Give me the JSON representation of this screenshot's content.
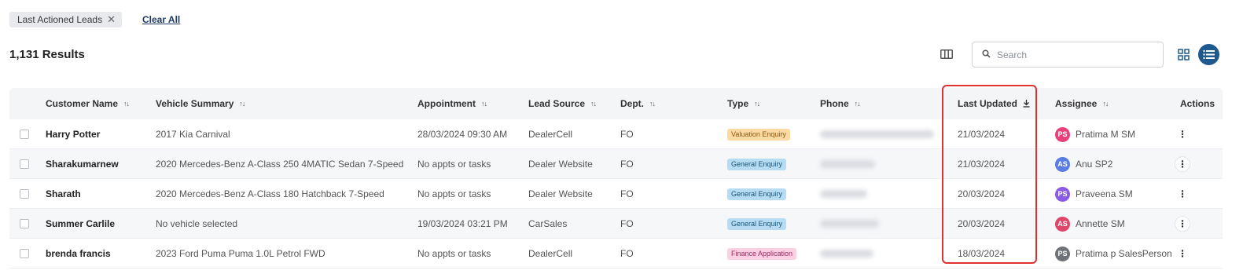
{
  "filters": {
    "chip_label": "Last Actioned Leads",
    "clear_all": "Clear All"
  },
  "results_label": "1,131 Results",
  "search": {
    "placeholder": "Search"
  },
  "table": {
    "headers": {
      "customer_name": "Customer Name",
      "vehicle_summary": "Vehicle Summary",
      "appointment": "Appointment",
      "lead_source": "Lead Source",
      "dept": "Dept.",
      "type": "Type",
      "phone": "Phone",
      "last_updated": "Last Updated",
      "assignee": "Assignee",
      "actions": "Actions"
    },
    "rows": [
      {
        "name": "Harry Potter",
        "vehicle": "2017 Kia Carnival",
        "appointment": "28/03/2024 09:30 AM",
        "source": "DealerCell",
        "dept": "FO",
        "type": "Valuation Enquiry",
        "type_bg": "#fdd9a3",
        "type_color": "#8a5a14",
        "last_updated": "21/03/2024",
        "assignee_initials": "PS",
        "assignee": "Pratima M SM",
        "avatar_color": "#e8407a"
      },
      {
        "name": "Sharakumarnew",
        "vehicle": "2020 Mercedes-Benz A-Class 250 4MATIC Sedan 7-Speed",
        "appointment": "No appts or tasks",
        "source": "Dealer Website",
        "dept": "FO",
        "type": "General Enquiry",
        "type_bg": "#b5dcf3",
        "type_color": "#1c5578",
        "last_updated": "21/03/2024",
        "assignee_initials": "AS",
        "assignee": "Anu SP2",
        "avatar_color": "#5b7de3"
      },
      {
        "name": "Sharath",
        "vehicle": "2020 Mercedes-Benz A-Class 180 Hatchback 7-Speed",
        "appointment": "No appts or tasks",
        "source": "Dealer Website",
        "dept": "FO",
        "type": "General Enquiry",
        "type_bg": "#b5dcf3",
        "type_color": "#1c5578",
        "last_updated": "20/03/2024",
        "assignee_initials": "PS",
        "assignee": "Praveena SM",
        "avatar_color": "#8b5be3"
      },
      {
        "name": "Summer Carlile",
        "vehicle": "No vehicle selected",
        "appointment": "19/03/2024 03:21 PM",
        "source": "CarSales",
        "dept": "FO",
        "type": "General Enquiry",
        "type_bg": "#b5dcf3",
        "type_color": "#1c5578",
        "last_updated": "20/03/2024",
        "assignee_initials": "AS",
        "assignee": "Annette SM",
        "avatar_color": "#e0466a"
      },
      {
        "name": "brenda francis",
        "vehicle": "2023 Ford Puma Puma 1.0L Petrol FWD",
        "appointment": "No appts or tasks",
        "source": "DealerCell",
        "dept": "FO",
        "type": "Finance Application",
        "type_bg": "#fbd0e3",
        "type_color": "#9c2b5e",
        "last_updated": "18/03/2024",
        "assignee_initials": "PS",
        "assignee": "Pratima p SalesPerson",
        "avatar_color": "#6e7177"
      }
    ]
  }
}
